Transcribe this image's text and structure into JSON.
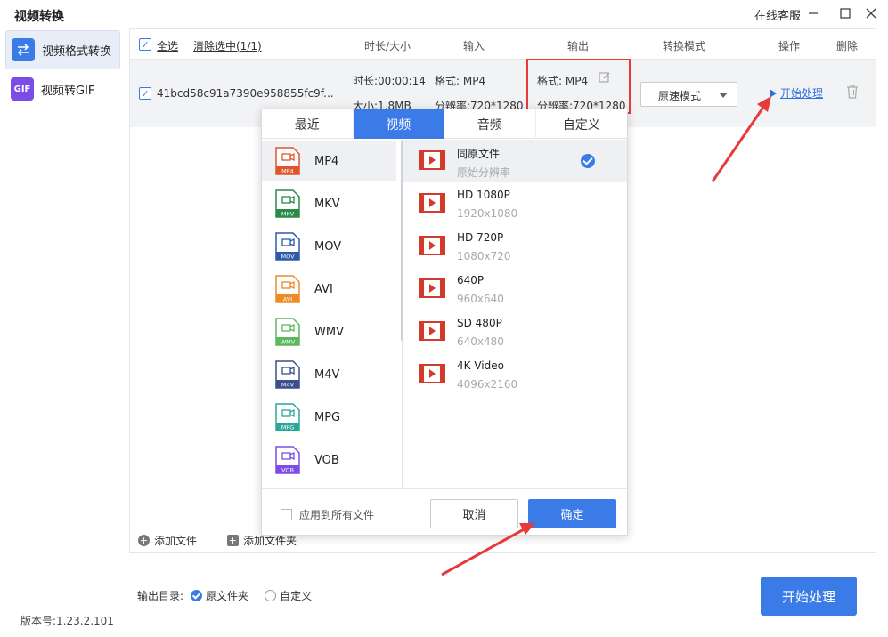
{
  "app": {
    "title": "视频转换",
    "online_service": "在线客服",
    "version": "版本号:1.23.2.101"
  },
  "sidebar": {
    "items": [
      {
        "label": "视频格式转换",
        "icon": "swap-arrows-icon",
        "color": "#3a7be8"
      },
      {
        "label": "视频转GIF",
        "icon": "gif-icon",
        "color": "#7b4de6"
      }
    ]
  },
  "table": {
    "headers": {
      "select_all": "全选",
      "clear": "清除选中(1/1)",
      "duration_size": "时长/大小",
      "input": "输入",
      "output": "输出",
      "mode": "转换模式",
      "action": "操作",
      "delete": "删除"
    },
    "row": {
      "filename": "41bcd58c91a7390e958855fc9f...",
      "duration": "时长:00:00:14",
      "size": "大小:1.8MB",
      "input_format": "格式: MP4",
      "input_resolution": "分辨率:720*1280",
      "output_format": "格式: MP4",
      "output_resolution": "分辨率:720*1280",
      "mode": "原速模式",
      "start": "开始处理"
    }
  },
  "footer": {
    "add_file": "添加文件",
    "add_folder": "添加文件夹",
    "output_dir_label": "输出目录:",
    "option_original": "原文件夹",
    "option_custom": "自定义",
    "start_button": "开始处理"
  },
  "popup": {
    "tabs": [
      "最近",
      "视频",
      "音频",
      "自定义"
    ],
    "active_tab": "视频",
    "formats": [
      {
        "name": "MP4",
        "color": "#e0562a"
      },
      {
        "name": "MKV",
        "color": "#2a8a4a"
      },
      {
        "name": "MOV",
        "color": "#2d5aa8"
      },
      {
        "name": "AVI",
        "color": "#f08a24"
      },
      {
        "name": "WMV",
        "color": "#5cb85c"
      },
      {
        "name": "M4V",
        "color": "#3c4f8a"
      },
      {
        "name": "MPG",
        "color": "#2aa79b"
      },
      {
        "name": "VOB",
        "color": "#7b4de6"
      }
    ],
    "resolutions": [
      {
        "name": "同原文件",
        "sub": "原始分辨率",
        "selected": true
      },
      {
        "name": "HD 1080P",
        "sub": "1920x1080"
      },
      {
        "name": "HD 720P",
        "sub": "1080x720"
      },
      {
        "name": "640P",
        "sub": "960x640"
      },
      {
        "name": "SD 480P",
        "sub": "640x480"
      },
      {
        "name": "4K Video",
        "sub": "4096x2160"
      }
    ],
    "apply_all": "应用到所有文件",
    "cancel": "取消",
    "ok": "确定"
  },
  "colors": {
    "accent": "#3a7be8",
    "annotation": "#e83a3a"
  }
}
